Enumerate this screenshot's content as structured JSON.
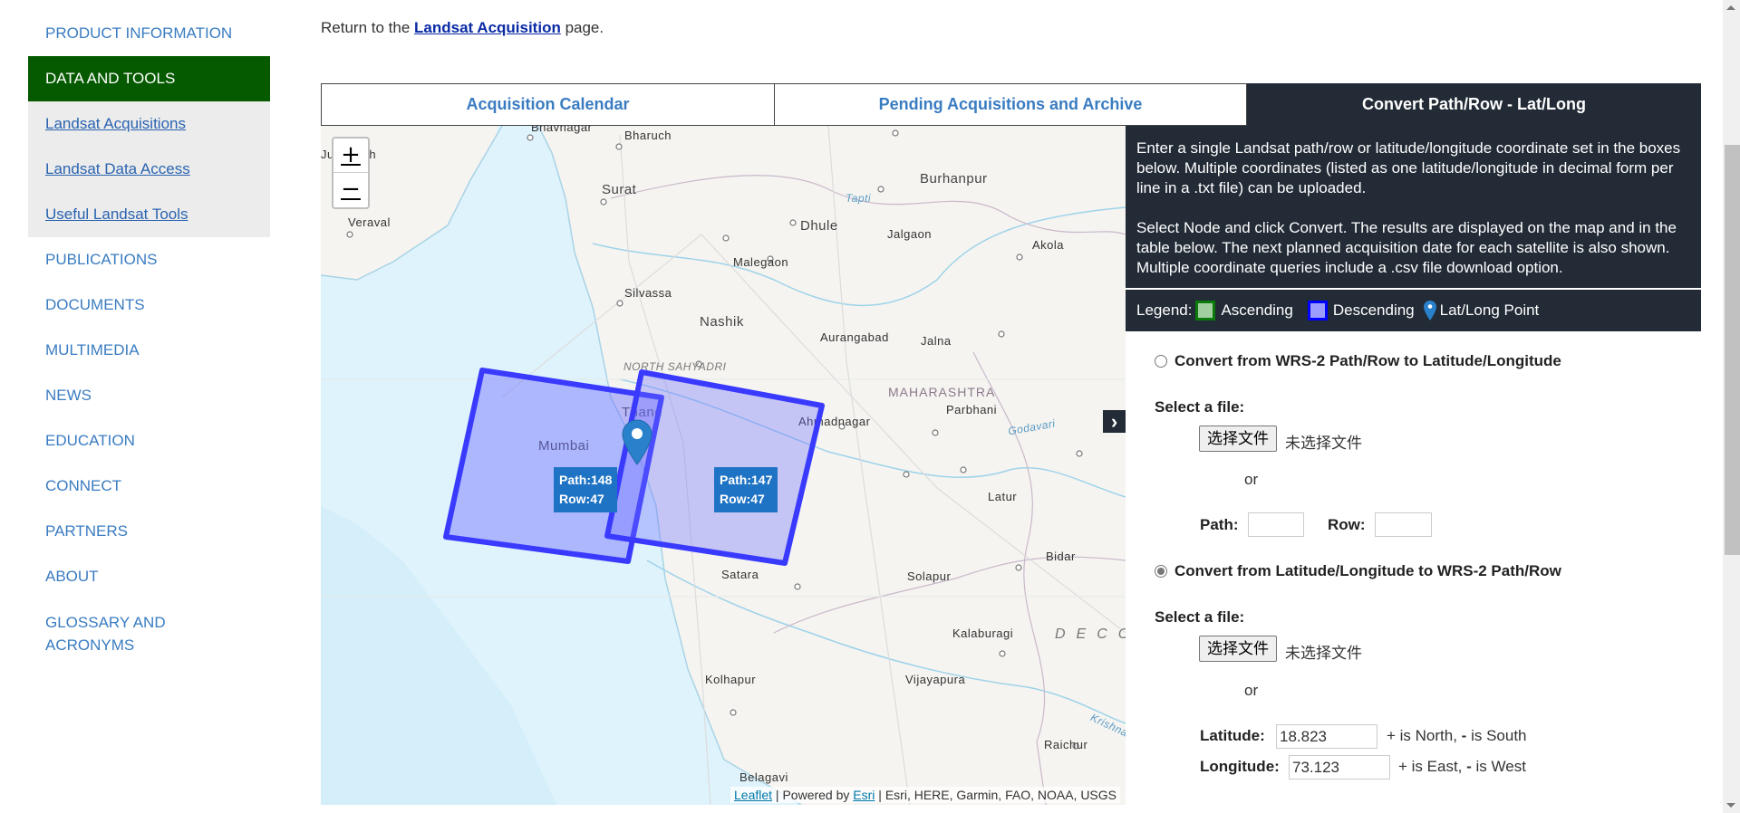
{
  "sidebar": {
    "items": [
      {
        "label": "PRODUCT INFORMATION"
      },
      {
        "label": "DATA AND TOOLS",
        "active": true
      },
      {
        "label": "PUBLICATIONS"
      },
      {
        "label": "DOCUMENTS"
      },
      {
        "label": "MULTIMEDIA"
      },
      {
        "label": "NEWS"
      },
      {
        "label": "EDUCATION"
      },
      {
        "label": "CONNECT"
      },
      {
        "label": "PARTNERS"
      },
      {
        "label": "ABOUT"
      },
      {
        "label": "GLOSSARY AND ACRONYMS"
      }
    ],
    "subitems": [
      {
        "label": "Landsat Acquisitions"
      },
      {
        "label": "Landsat Data Access"
      },
      {
        "label": "Useful Landsat Tools"
      }
    ]
  },
  "intro": {
    "prefix": "Return to the ",
    "link": "Landsat Acquisition",
    "suffix": " page."
  },
  "tabs": [
    {
      "label": "Acquisition Calendar"
    },
    {
      "label": "Pending Acquisitions and Archive"
    },
    {
      "label": "Convert Path/Row - Lat/Long",
      "active": true
    }
  ],
  "map": {
    "zoom_in": "+",
    "zoom_out": "−",
    "toggle_icon": "›",
    "labels": {
      "bhavnagar": "Bhavnagar",
      "bharuch": "Bharuch",
      "junagadh": "Junagadh",
      "surat": "Surat",
      "veraval": "Veraval",
      "silvassa": "Silvassa",
      "nashik": "Nashik",
      "malegaon": "Malegaon",
      "dhule": "Dhule",
      "jalgaon": "Jalgaon",
      "burhanpur": "Burhanpur",
      "tapti": "Tapti",
      "akola": "Akola",
      "aurangabad": "Aurangabad",
      "jalna": "Jalna",
      "maharashtra": "MAHARASHTRA",
      "parbhani": "Parbhani",
      "godavari": "Godavari",
      "ahmadnagar": "Ahmadnagar",
      "north_sahyadri": "NORTH SAHYADRI",
      "mumbai": "Mumbai",
      "thane": "Thane",
      "latur": "Latur",
      "bidar": "Bidar",
      "satara": "Satara",
      "solapur": "Solapur",
      "kalaburagi": "Kalaburagi",
      "deccan": "DECC",
      "kolhapur": "Kolhapur",
      "vijayapura": "Vijayapura",
      "krishna": "Krishna",
      "raichur": "Raichur",
      "belagavi": "Belagavi"
    },
    "scenes": [
      {
        "path_label": "Path:148",
        "row_label": "Row:47",
        "type": "Descending"
      },
      {
        "path_label": "Path:147",
        "row_label": "Row:47",
        "type": "Descending"
      }
    ],
    "attribution": {
      "leaflet": "Leaflet",
      "powered": " | Powered by ",
      "esri": "Esri",
      "sources": " | Esri, HERE, Garmin, FAO, NOAA, USGS"
    }
  },
  "info": {
    "p1": "Enter a single Landsat path/row or latitude/longitude coordinate set in the boxes below. Multiple coordinates (listed as one latitude/longitude in decimal form per line in a .txt file) can be uploaded.",
    "p2": "Select Node and click Convert. The results are displayed on the map and in the table below. The next planned acquisition date for each satellite is also shown. Multiple coordinate queries include a .csv file download option."
  },
  "legend": {
    "title": "Legend:",
    "ascending": "Ascending",
    "descending": "Descending",
    "point": "Lat/Long Point",
    "colors": {
      "ascending": "#0a7a0a",
      "descending": "#0000ff",
      "point": "#2a81cb"
    }
  },
  "form": {
    "option1": {
      "label": "Convert from WRS-2 Path/Row to Latitude/Longitude",
      "checked": false,
      "select_file": "Select a file:",
      "file_button": "选择文件",
      "file_status": "未选择文件",
      "or": "or",
      "path_label": "Path:",
      "path_value": "",
      "row_label": "Row:",
      "row_value": ""
    },
    "option2": {
      "label": "Convert from Latitude/Longitude to WRS-2 Path/Row",
      "checked": true,
      "select_file": "Select a file:",
      "file_button": "选择文件",
      "file_status": "未选择文件",
      "or": "or",
      "lat_label": "Latitude:",
      "lat_value": "18.823",
      "lat_hint_plus": "+ is North, ",
      "lat_hint_minus": "-",
      "lat_hint_rest": " is South",
      "lon_label": "Longitude:",
      "lon_value": "73.123",
      "lon_hint_plus": "+ is East, ",
      "lon_hint_minus": "-",
      "lon_hint_rest": " is West"
    }
  }
}
